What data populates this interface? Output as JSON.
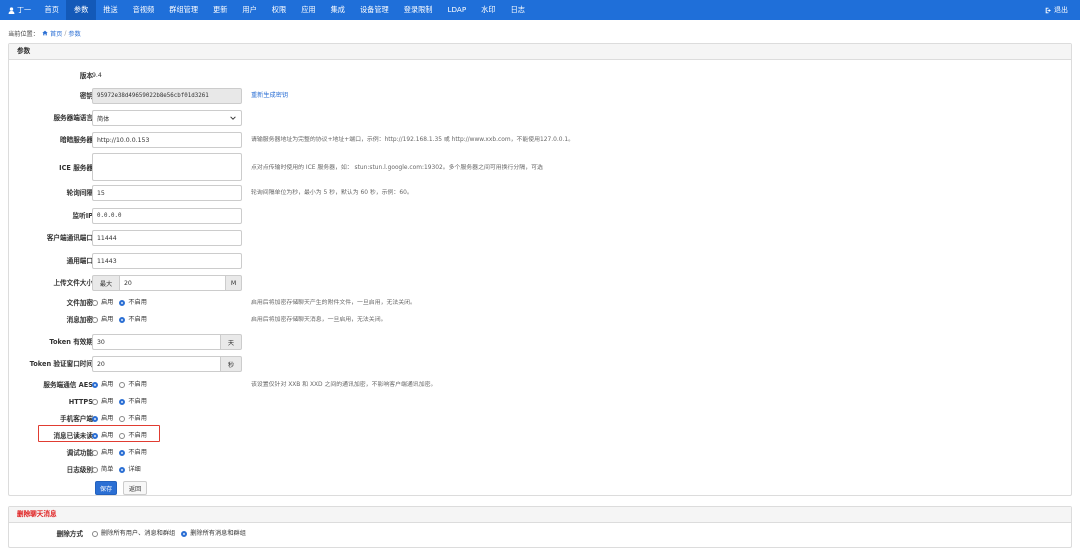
{
  "nav": {
    "user": "丁一",
    "items": [
      "首页",
      "参数",
      "推送",
      "音视频",
      "群组管理",
      "更新",
      "用户",
      "权限",
      "应用",
      "集成",
      "设备管理",
      "登录限制",
      "LDAP",
      "水印",
      "日志"
    ],
    "active_index": 1,
    "logout": "退出"
  },
  "breadcrumb": {
    "prefix": "当前位置：",
    "home": "首页",
    "current": "参数"
  },
  "params": {
    "title": "参数",
    "version_label": "版本",
    "version_value": "9.4",
    "key_label": "密钥",
    "key_value": "95972e38d49659022b8e56cbf01d3261",
    "key_regen": "重新生成密钥",
    "lang_label": "服务器端语言",
    "lang_value": "简体",
    "relay_label": "暗暗服务器",
    "relay_value": "http://10.0.0.153",
    "relay_help": "请输服务器地址为完整的协议+地址+端口，示例：http://192.168.1.35 或 http://www.xxb.com，不能使用127.0.0.1。",
    "ice_label": "ICE 服务器",
    "ice_value": "",
    "ice_help": "点对点传输时使用的 ICE 服务器，如： stun:stun.l.google.com:19302。多个服务器之间可用换行分隔，可选",
    "poll_label": "轮询间隔",
    "poll_value": "15",
    "poll_help": "轮询间隔单位为秒，最小为 5 秒，默认为 60 秒，示例：60。",
    "listen_ip_label": "监听IP",
    "listen_ip_value": "0.0.0.0",
    "client_port_label": "客户端通讯端口",
    "client_port_value": "11444",
    "common_port_label": "通用端口",
    "common_port_value": "11443",
    "upload_label": "上传文件大小",
    "upload_prefix": "最大",
    "upload_value": "20",
    "upload_unit": "M",
    "file_encrypt_label": "文件加密",
    "file_encrypt_help": "启用后将加密存储聊天产生的附件文件，一旦启用，无法关闭。",
    "msg_encrypt_label": "消息加密",
    "msg_encrypt_help": "启用后将加密存储聊天消息，一旦启用，无法关闭。",
    "token_label": "Token 有效期",
    "token_value": "30",
    "token_unit": "天",
    "token_window_label": "Token 验证窗口时间",
    "token_window_value": "20",
    "token_window_unit": "秒",
    "aes_label": "服务端通信 AES",
    "aes_help": "该设置仅针对 XXB 和 XXD 之间的通讯加密，不影响客户端通讯加密。",
    "https_label": "HTTPS",
    "mobile_label": "手机客户端",
    "read_label": "消息已读未读",
    "debug_label": "调试功能",
    "log_label": "日志级别",
    "enable": "启用",
    "disable": "不启用",
    "simple": "简单",
    "detail": "详细",
    "save": "保存",
    "back": "返回"
  },
  "delete_panel": {
    "title": "删除聊天消息",
    "mode_label": "删除方式",
    "opt1": "删除所有用户、消息和群组",
    "opt2": "删除所有消息和群组"
  },
  "colors": {
    "nav": "#1f6fd9",
    "primary": "#2b6fd4",
    "highlight": "#e03c31"
  }
}
